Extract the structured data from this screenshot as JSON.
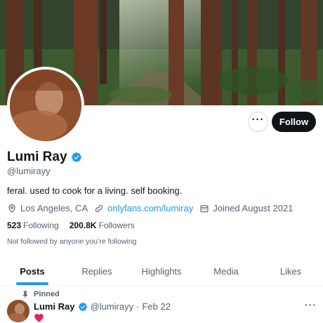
{
  "profile": {
    "display_name": "Lumi Ray",
    "handle": "@lumirayy",
    "bio": "feral. used to cook for a living. self booking.",
    "location": "Los Angeles, CA",
    "website": "onlyfans.com/lumiray",
    "joined": "Joined August 2021",
    "following_count": "523",
    "following_label": "Following",
    "followers_count": "200.8K",
    "followers_label": "Followers",
    "not_followed_text": "Not followed by anyone you’re following"
  },
  "actions": {
    "more_label": "···",
    "follow_label": "Follow"
  },
  "tabs": [
    {
      "label": "Posts",
      "active": true
    },
    {
      "label": "Replies",
      "active": false
    },
    {
      "label": "Highlights",
      "active": false
    },
    {
      "label": "Media",
      "active": false
    },
    {
      "label": "Likes",
      "active": false
    }
  ],
  "pinned_tweet": {
    "pinned_label": "Pinned",
    "author_name": "Lumi Ray",
    "author_handle": "@lumirayy",
    "separator": "·",
    "date": "Feb 22",
    "more_label": "···",
    "content_icon": "red-heart-icon"
  },
  "colors": {
    "accent": "#1d9bf0",
    "text_primary": "#0f1419",
    "text_secondary": "#536471",
    "follow_button_bg": "#0f1419",
    "heart": "#e0245e"
  }
}
